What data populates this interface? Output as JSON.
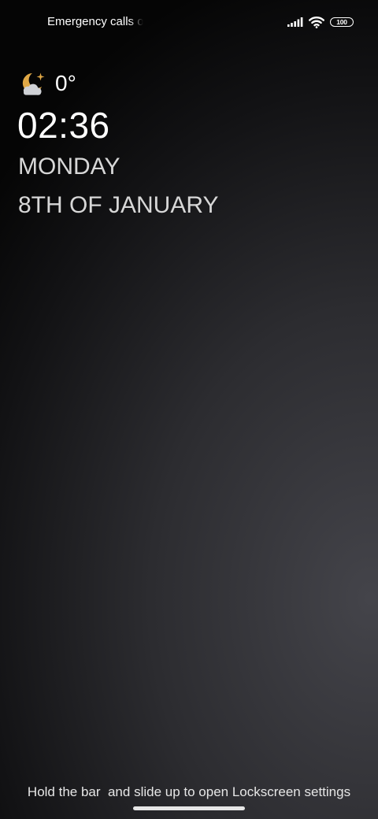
{
  "status_bar": {
    "carrier_text": "Emergency calls only",
    "battery_level": "100",
    "signal_icon": "cellular-signal-icon",
    "wifi_icon": "wifi-icon"
  },
  "weather": {
    "icon": "moon-cloud-icon",
    "temperature": "0°"
  },
  "clock": {
    "time": "02:36",
    "weekday": "MONDAY",
    "date": "8TH OF JANUARY"
  },
  "footer": {
    "hint": "Hold the bar  and slide up to open Lockscreen settings"
  },
  "colors": {
    "weather_icon": "#e0a846",
    "text_primary": "#ffffff",
    "text_secondary": "#d7d7d7"
  }
}
